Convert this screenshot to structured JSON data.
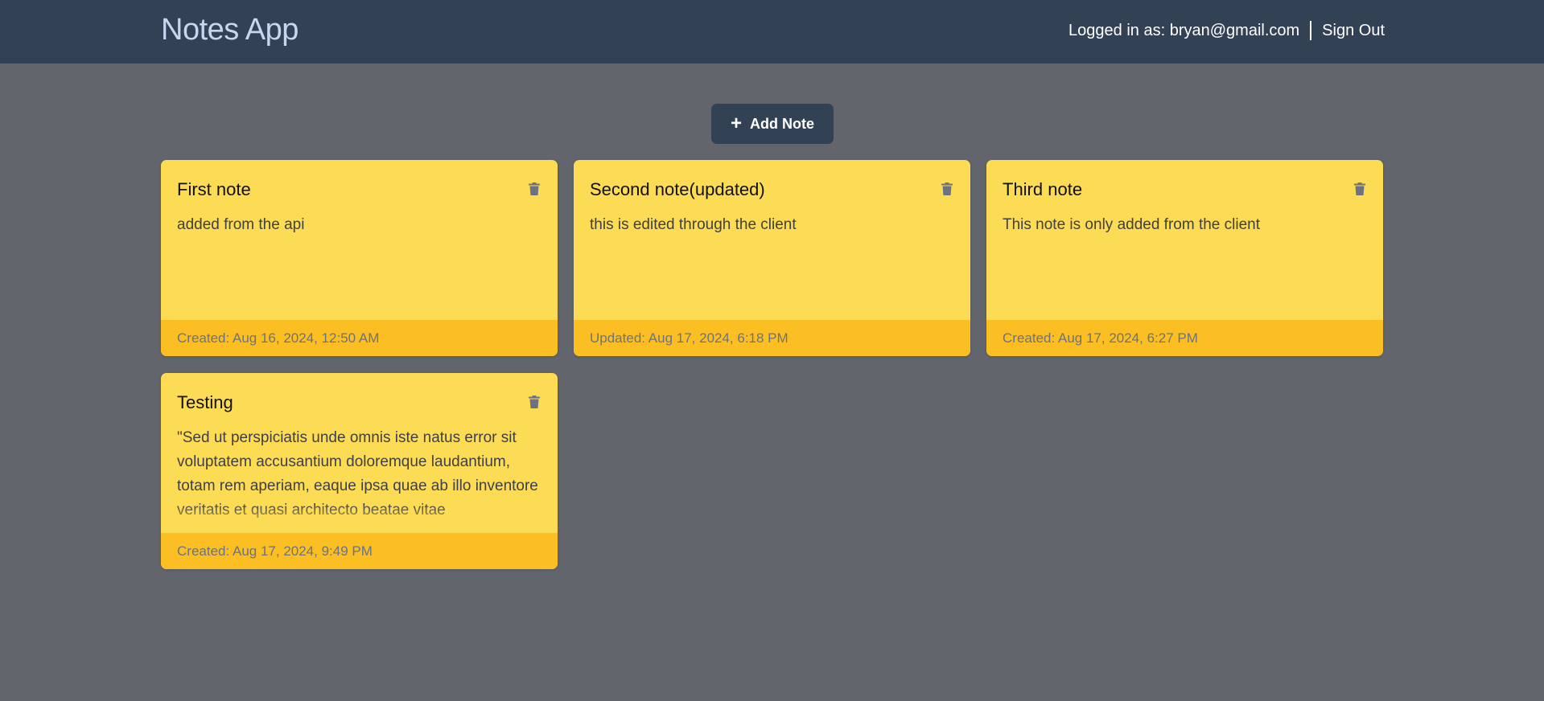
{
  "header": {
    "brand": "Notes App",
    "logged_in_text": "Logged in as: bryan@gmail.com",
    "sign_out_label": "Sign Out"
  },
  "toolbar": {
    "add_icon": "+",
    "add_label": "Add Note"
  },
  "notes": [
    {
      "title": "First note",
      "body": "added from the api",
      "footer": "Created: Aug 16, 2024, 12:50 AM",
      "icon": "trash-icon"
    },
    {
      "title": "Second note(updated)",
      "body": "this is edited through the client",
      "footer": "Updated: Aug 17, 2024, 6:18 PM",
      "icon": "trash-icon"
    },
    {
      "title": "Third note",
      "body": "This note is only added from the client",
      "footer": "Created: Aug 17, 2024, 6:27 PM",
      "icon": "trash-icon"
    },
    {
      "title": "Testing",
      "body": "\"Sed ut perspiciatis unde omnis iste natus error sit voluptatem accusantium doloremque laudantium, totam rem aperiam, eaque ipsa quae ab illo inventore veritatis et quasi architecto beatae vitae",
      "footer": "Created: Aug 17, 2024, 9:49 PM",
      "icon": "trash-icon"
    }
  ],
  "colors": {
    "background": "#62656b",
    "header": "#334155",
    "brand": "#c7d6ee",
    "card": "#fddc55",
    "card_footer": "#fbbf24"
  }
}
